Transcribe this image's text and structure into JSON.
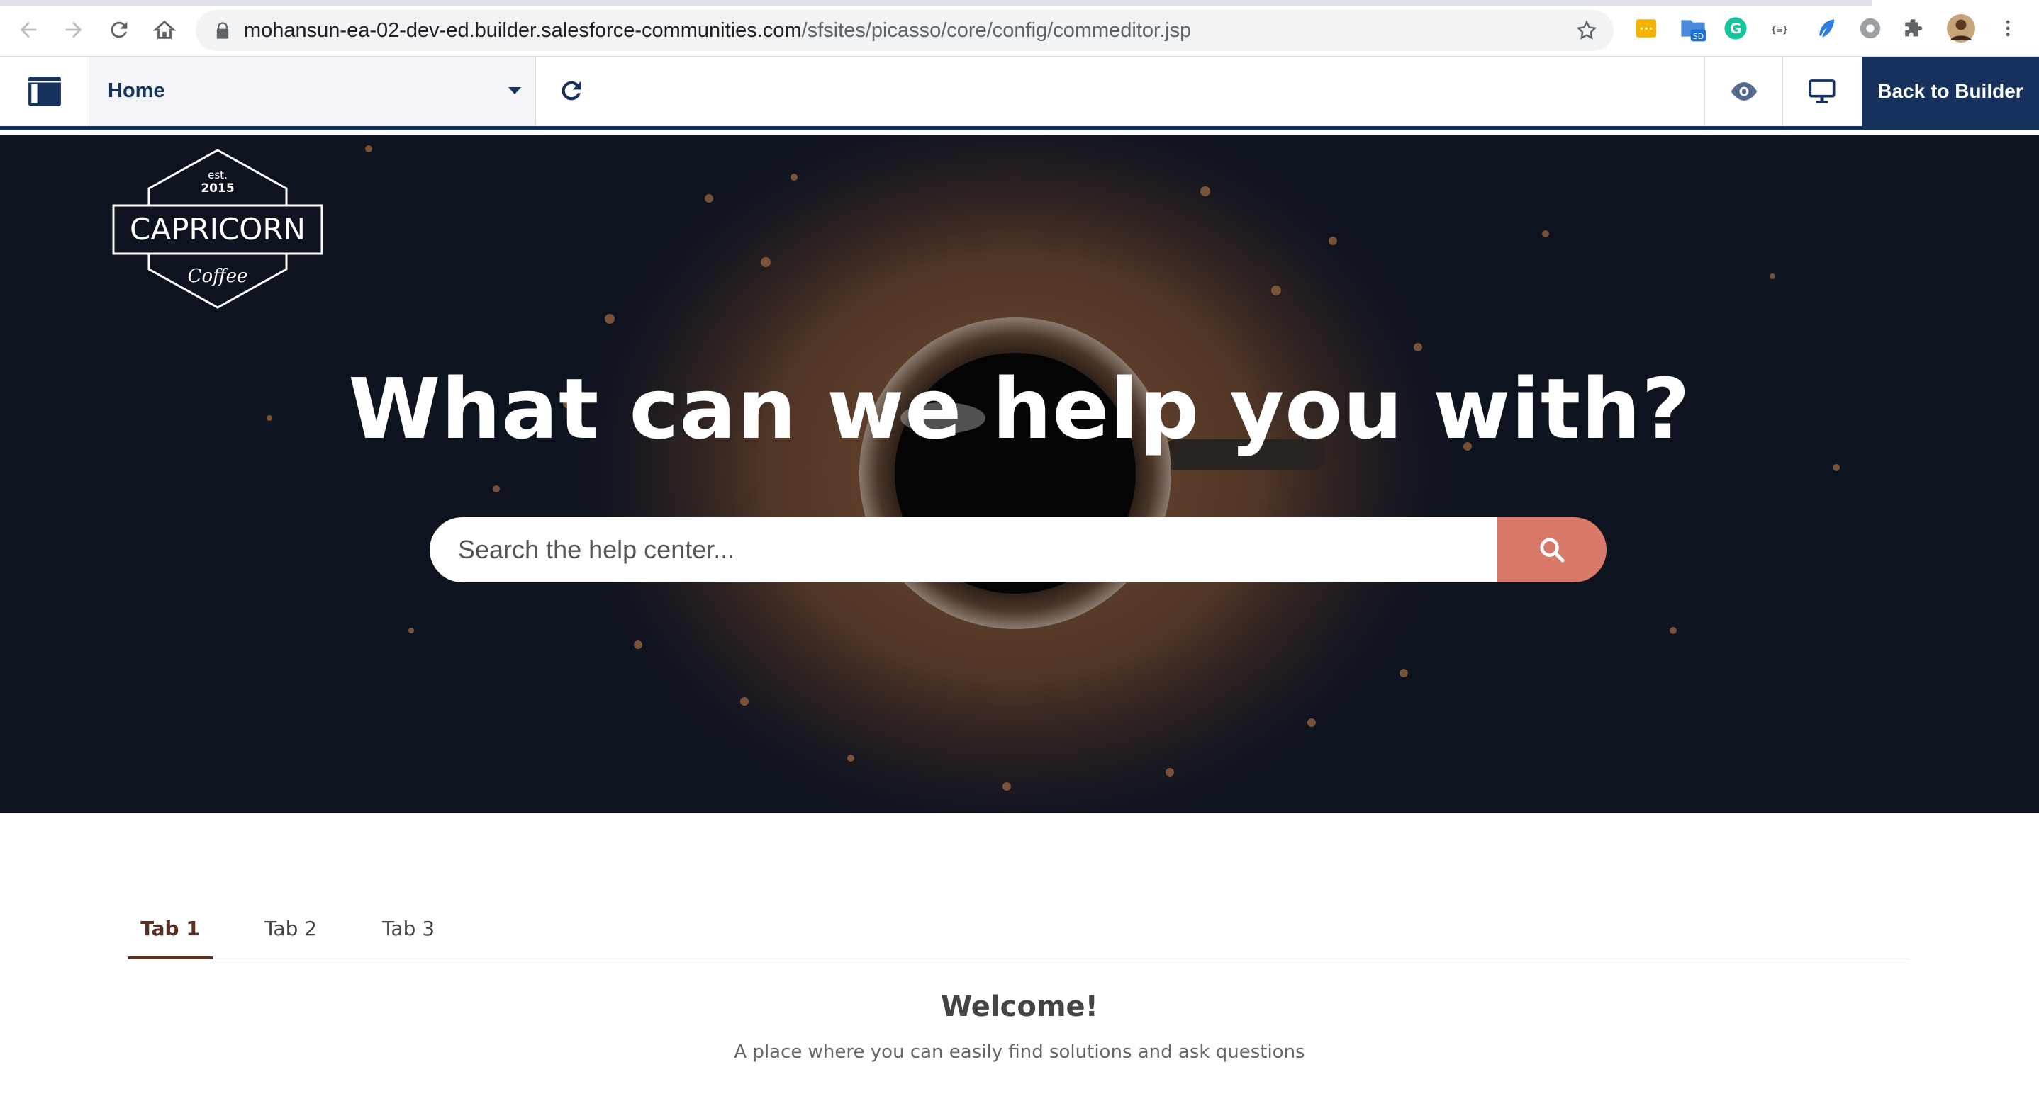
{
  "browser": {
    "url_host": "mohansun-ea-02-dev-ed.builder.salesforce-communities.com",
    "url_path": "/sfsites/picasso/core/config/commeditor.jsp",
    "extension_badge": "SD"
  },
  "builder": {
    "page_label": "Home",
    "back_label": "Back to Builder"
  },
  "hero": {
    "logo_top": "est.",
    "logo_year": "2015",
    "logo_name": "CAPRICORN",
    "logo_sub": "Coffee",
    "headline": "What can we help you with?",
    "search_placeholder": "Search the help center..."
  },
  "tabs": [
    {
      "label": "Tab 1",
      "active": true
    },
    {
      "label": "Tab 2",
      "active": false
    },
    {
      "label": "Tab 3",
      "active": false
    }
  ],
  "content": {
    "welcome": "Welcome!",
    "tagline": "A place where you can easily find solutions and ask questions"
  },
  "colors": {
    "navy": "#16325c",
    "search_button": "#d9796a",
    "active_tab": "#5a2f20"
  }
}
